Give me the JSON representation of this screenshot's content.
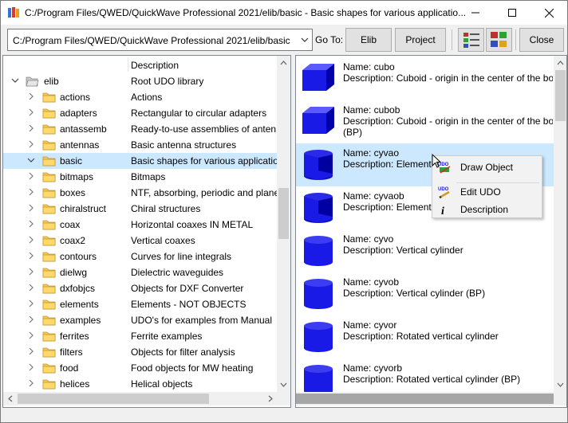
{
  "window": {
    "title": "C:/Program Files/QWED/QuickWave Professional 2021/elib/basic - Basic shapes for various applicatio..."
  },
  "toolbar": {
    "path_value": "C:/Program Files/QWED/QuickWave Professional 2021/elib/basic",
    "goto_label": "Go To:",
    "elib_button": "Elib",
    "project_button": "Project",
    "close_button": "Close"
  },
  "tree": {
    "description_header": "Description",
    "root": {
      "name": "elib",
      "description": "Root UDO library"
    },
    "items": [
      {
        "name": "actions",
        "description": "Actions"
      },
      {
        "name": "adapters",
        "description": "Rectangular to circular adapters"
      },
      {
        "name": "antassemb",
        "description": "Ready-to-use assemblies of antennas"
      },
      {
        "name": "antennas",
        "description": "Basic antenna structures"
      },
      {
        "name": "basic",
        "description": "Basic shapes for various applications",
        "selected": true
      },
      {
        "name": "bitmaps",
        "description": "Bitmaps"
      },
      {
        "name": "boxes",
        "description": "NTF, absorbing, periodic and plane"
      },
      {
        "name": "chiralstruct",
        "description": "Chiral structures"
      },
      {
        "name": "coax",
        "description": "Horizontal coaxes IN METAL"
      },
      {
        "name": "coax2",
        "description": "Vertical coaxes"
      },
      {
        "name": "contours",
        "description": "Curves for line integrals"
      },
      {
        "name": "dielwg",
        "description": "Dielectric waveguides"
      },
      {
        "name": "dxfobjcs",
        "description": "Objects for DXF Converter"
      },
      {
        "name": "elements",
        "description": "Elements - NOT OBJECTS"
      },
      {
        "name": "examples",
        "description": "UDO's for examples from Manual"
      },
      {
        "name": "ferrites",
        "description": "Ferrite examples"
      },
      {
        "name": "filters",
        "description": "Objects for filter analysis"
      },
      {
        "name": "food",
        "description": "Food objects for MW heating"
      },
      {
        "name": "helices",
        "description": "Helical objects"
      }
    ]
  },
  "objects": [
    {
      "name": "Name: cubo",
      "description": "Description: Cuboid - origin in the center of the bo",
      "extra": "",
      "shape": "cube"
    },
    {
      "name": "Name: cubob",
      "description": "Description: Cuboid - origin in the center of the bo",
      "extra": "(BP)",
      "shape": "cube"
    },
    {
      "name": "Name: cyvao",
      "description": "Description: Element",
      "extra": "",
      "shape": "cyl-cut",
      "selected": true
    },
    {
      "name": "Name: cyvaob",
      "description": "Description: Element",
      "extra": "",
      "shape": "cyl-cut"
    },
    {
      "name": "Name: cyvo",
      "description": "Description: Vertical cylinder",
      "extra": "",
      "shape": "cylinder"
    },
    {
      "name": "Name: cyvob",
      "description": "Description: Vertical cylinder (BP)",
      "extra": "",
      "shape": "cylinder"
    },
    {
      "name": "Name: cyvor",
      "description": "Description: Rotated vertical cylinder",
      "extra": "",
      "shape": "cylinder"
    },
    {
      "name": "Name: cyvorb",
      "description": "Description: Rotated vertical cylinder (BP)",
      "extra": "",
      "shape": "cylinder"
    }
  ],
  "context_menu": {
    "draw_object": "Draw Object",
    "edit_udo": "Edit UDO",
    "description": "Description",
    "udo_icon_text": "UDO"
  },
  "colors": {
    "selection": "#cce8ff",
    "shape_blue": "#1a1ae6",
    "folder": "#f5c85a"
  }
}
